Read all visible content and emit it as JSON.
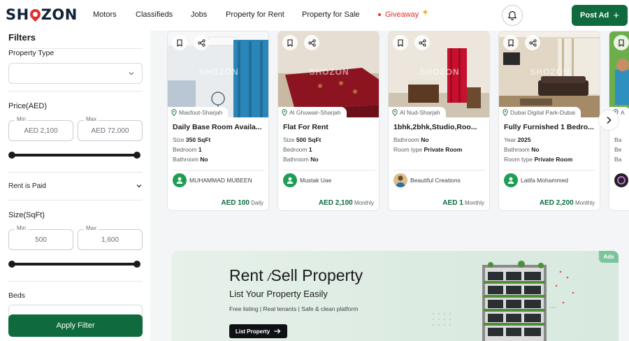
{
  "header": {
    "logo_left": "SH",
    "logo_right": "ZON",
    "nav": [
      "Motors",
      "Classifieds",
      "Jobs",
      "Property for Rent",
      "Property for Sale"
    ],
    "giveaway": "Giveaway",
    "post_ad": "Post Ad",
    "colors": {
      "brand_green": "#0f6b3e",
      "giveaway_red": "#e03131"
    }
  },
  "sidebar": {
    "title": "Filters",
    "property_type": {
      "label": "Property Type",
      "value": ""
    },
    "price": {
      "title": "Price(AED)",
      "min_caption": "Min",
      "min_value": "AED 2,100",
      "max_caption": "Max",
      "max_value": "AED 72,000"
    },
    "rent_paid": "Rent is Paid",
    "size": {
      "title": "Size(SqFt)",
      "min_caption": "Min",
      "min_value": "500",
      "max_caption": "Max",
      "max_value": "1,600"
    },
    "beds": "Beds",
    "apply": "Apply Filter"
  },
  "listings": [
    {
      "location": "Masfout-Sharjah",
      "title": "Daily Base Room Availa...",
      "attrs": [
        {
          "k": "Size",
          "v": "350 SqFt"
        },
        {
          "k": "Bedroom",
          "v": "1"
        },
        {
          "k": "Bathroom",
          "v": "No"
        }
      ],
      "seller": "MUHAMMAD MUBEEN",
      "price": "AED 100",
      "period": "Daily",
      "watermark": "SHOZON"
    },
    {
      "location": "Al Ghuwair-Sharjah",
      "title": "Flat For Rent",
      "attrs": [
        {
          "k": "Size",
          "v": "500 SqFt"
        },
        {
          "k": "Bedroom",
          "v": "1"
        },
        {
          "k": "Bathroom",
          "v": "No"
        }
      ],
      "seller": "Mustak Uae",
      "price": "AED 2,100",
      "period": "Monthly",
      "watermark": "SHOZON"
    },
    {
      "location": "Al Nud-Sharjah",
      "title": "1bhk,2bhk,Studio,Roo...",
      "attrs": [
        {
          "k": "Bathroom",
          "v": "No"
        },
        {
          "k": "Room type",
          "v": "Private Room"
        }
      ],
      "seller": "Beautiful Creations",
      "price": "AED 1",
      "period": "Monthly",
      "watermark": "SHOZON"
    },
    {
      "location": "Dubai Digital Park-Dubai",
      "title": "Fully Furnished 1 Bedro...",
      "attrs": [
        {
          "k": "Year",
          "v": "2025"
        },
        {
          "k": "Bathroom",
          "v": "No"
        },
        {
          "k": "Room type",
          "v": "Private Room"
        }
      ],
      "seller": "Latifa Mohammed",
      "price": "AED 2,200",
      "period": "Monthly",
      "watermark": "SHOZON"
    },
    {
      "location": "A",
      "title": "",
      "attrs": [
        {
          "k": "Ba",
          "v": ""
        },
        {
          "k": "Be",
          "v": ""
        },
        {
          "k": "Ba",
          "v": ""
        }
      ],
      "seller": "",
      "price": "",
      "period": ""
    }
  ],
  "banner": {
    "title_a": "Rent",
    "title_slash": "/",
    "title_b": "Sell Property",
    "subtitle": "List Your Property Easily",
    "features": "Free listing | Real tenants | Safe & clean platform",
    "cta": "List Property",
    "badge": "Ads"
  }
}
